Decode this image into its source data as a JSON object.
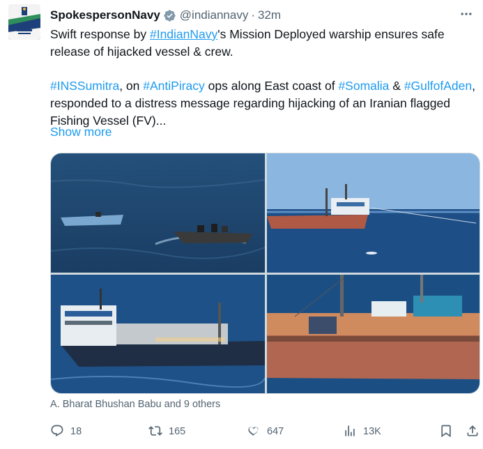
{
  "tweet": {
    "display_name": "SpokespersonNavy",
    "handle": "@indiannavy",
    "separator": "·",
    "time": "32m",
    "text": {
      "p1_before": "Swift response by ",
      "p1_tag": "#IndianNavy",
      "p1_after": "'s Mission Deployed warship ensures safe release of hijacked vessel & crew.",
      "tag_inssumitra": "#INSSumitra",
      "p2_t1": ", on ",
      "tag_antipiracy": "#AntiPiracy",
      "p2_t2": " ops along East coast of ",
      "tag_somalia": "#Somalia",
      "p2_t3": " & ",
      "tag_gulfofaden": "#GulfofAden",
      "p2_t4": ", responded to a distress message regarding hijacking of an Iranian flagged Fishing Vessel (FV)..."
    },
    "show_more": "Show more",
    "tagged_people": "A. Bharat Bhushan Babu and 9 others"
  },
  "actions": {
    "replies": "18",
    "reposts": "165",
    "likes": "647",
    "views": "13K"
  },
  "colors": {
    "accent": "#1d9bf0",
    "muted": "#536471",
    "text": "#0f1419",
    "verified": "#829aab"
  },
  "icons": [
    "more-options-icon",
    "verified-badge-icon",
    "reply-icon",
    "repost-icon",
    "like-icon",
    "views-icon",
    "bookmark-icon",
    "share-icon"
  ]
}
